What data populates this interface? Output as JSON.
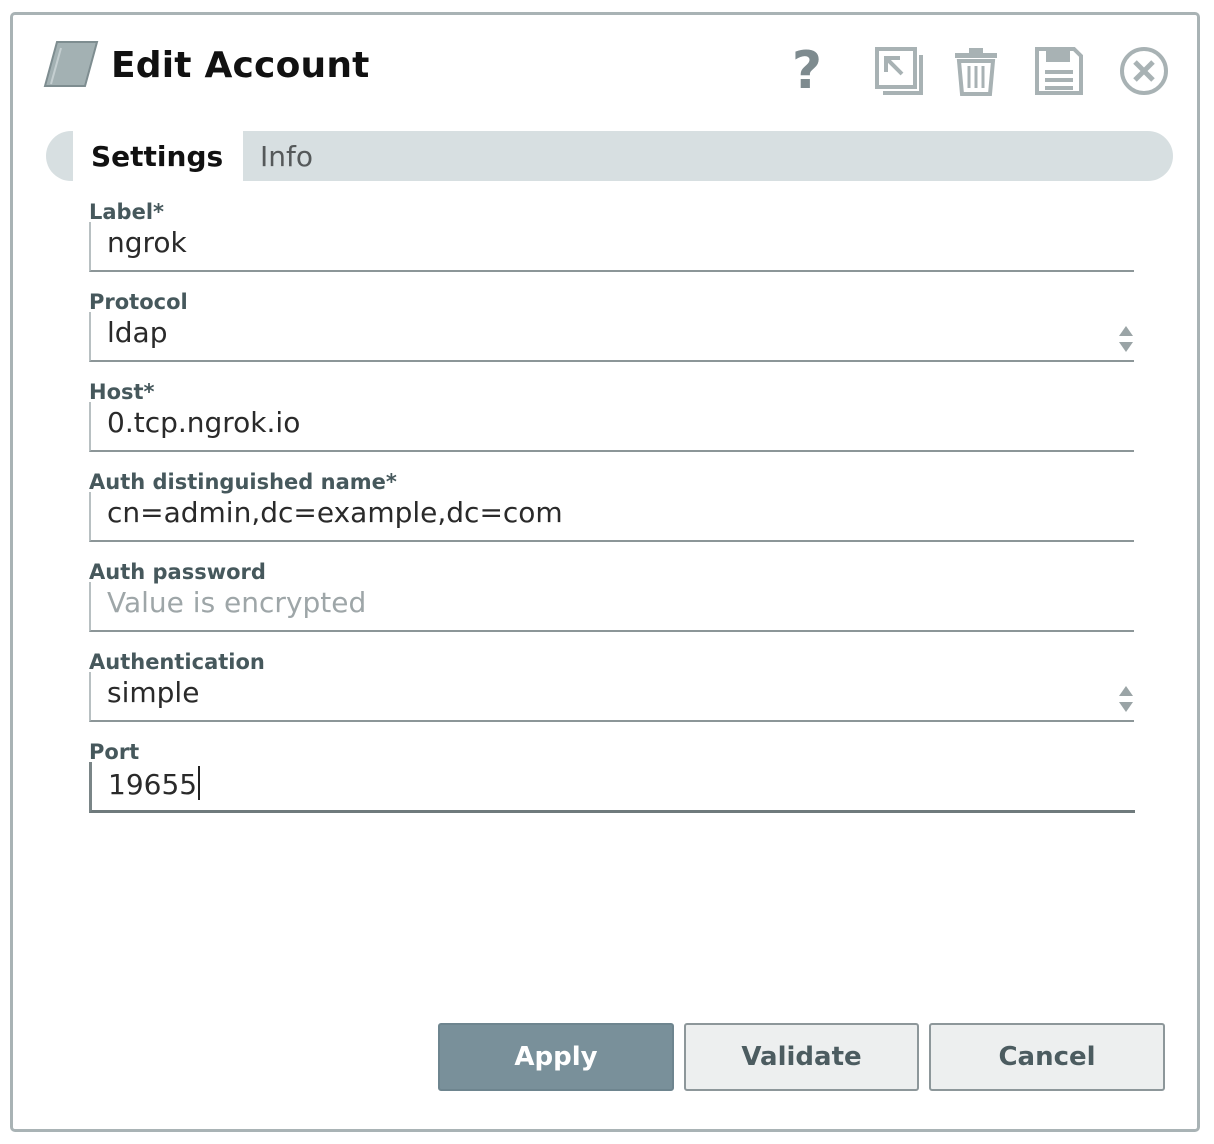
{
  "header": {
    "title": "Edit Account",
    "logo_icon": "account-parallelogram-icon",
    "toolbar": {
      "help_label": "?",
      "help_icon": "help-icon",
      "export_icon": "export-icon",
      "delete_icon": "trash-icon",
      "save_icon": "save-disk-icon",
      "close_icon": "close-circle-icon"
    }
  },
  "tabs": [
    {
      "label": "Settings",
      "active": true
    },
    {
      "label": "Info",
      "active": false
    }
  ],
  "form": {
    "label": {
      "label": "Label*",
      "value": "ngrok"
    },
    "protocol": {
      "label": "Protocol",
      "value": "ldap"
    },
    "host": {
      "label": "Host*",
      "value": "0.tcp.ngrok.io"
    },
    "auth_dn": {
      "label": "Auth distinguished name*",
      "value": "cn=admin,dc=example,dc=com"
    },
    "auth_password": {
      "label": "Auth password",
      "placeholder": "Value is encrypted",
      "value": ""
    },
    "authentication": {
      "label": "Authentication",
      "value": "simple"
    },
    "port": {
      "label": "Port",
      "value": "19655"
    }
  },
  "buttons": {
    "apply": "Apply",
    "validate": "Validate",
    "cancel": "Cancel"
  },
  "colors": {
    "accent_button": "#79909a",
    "tab_bar": "#d7dfe1",
    "label_text": "#46585c",
    "icon_gray": "#a8b2b4"
  }
}
